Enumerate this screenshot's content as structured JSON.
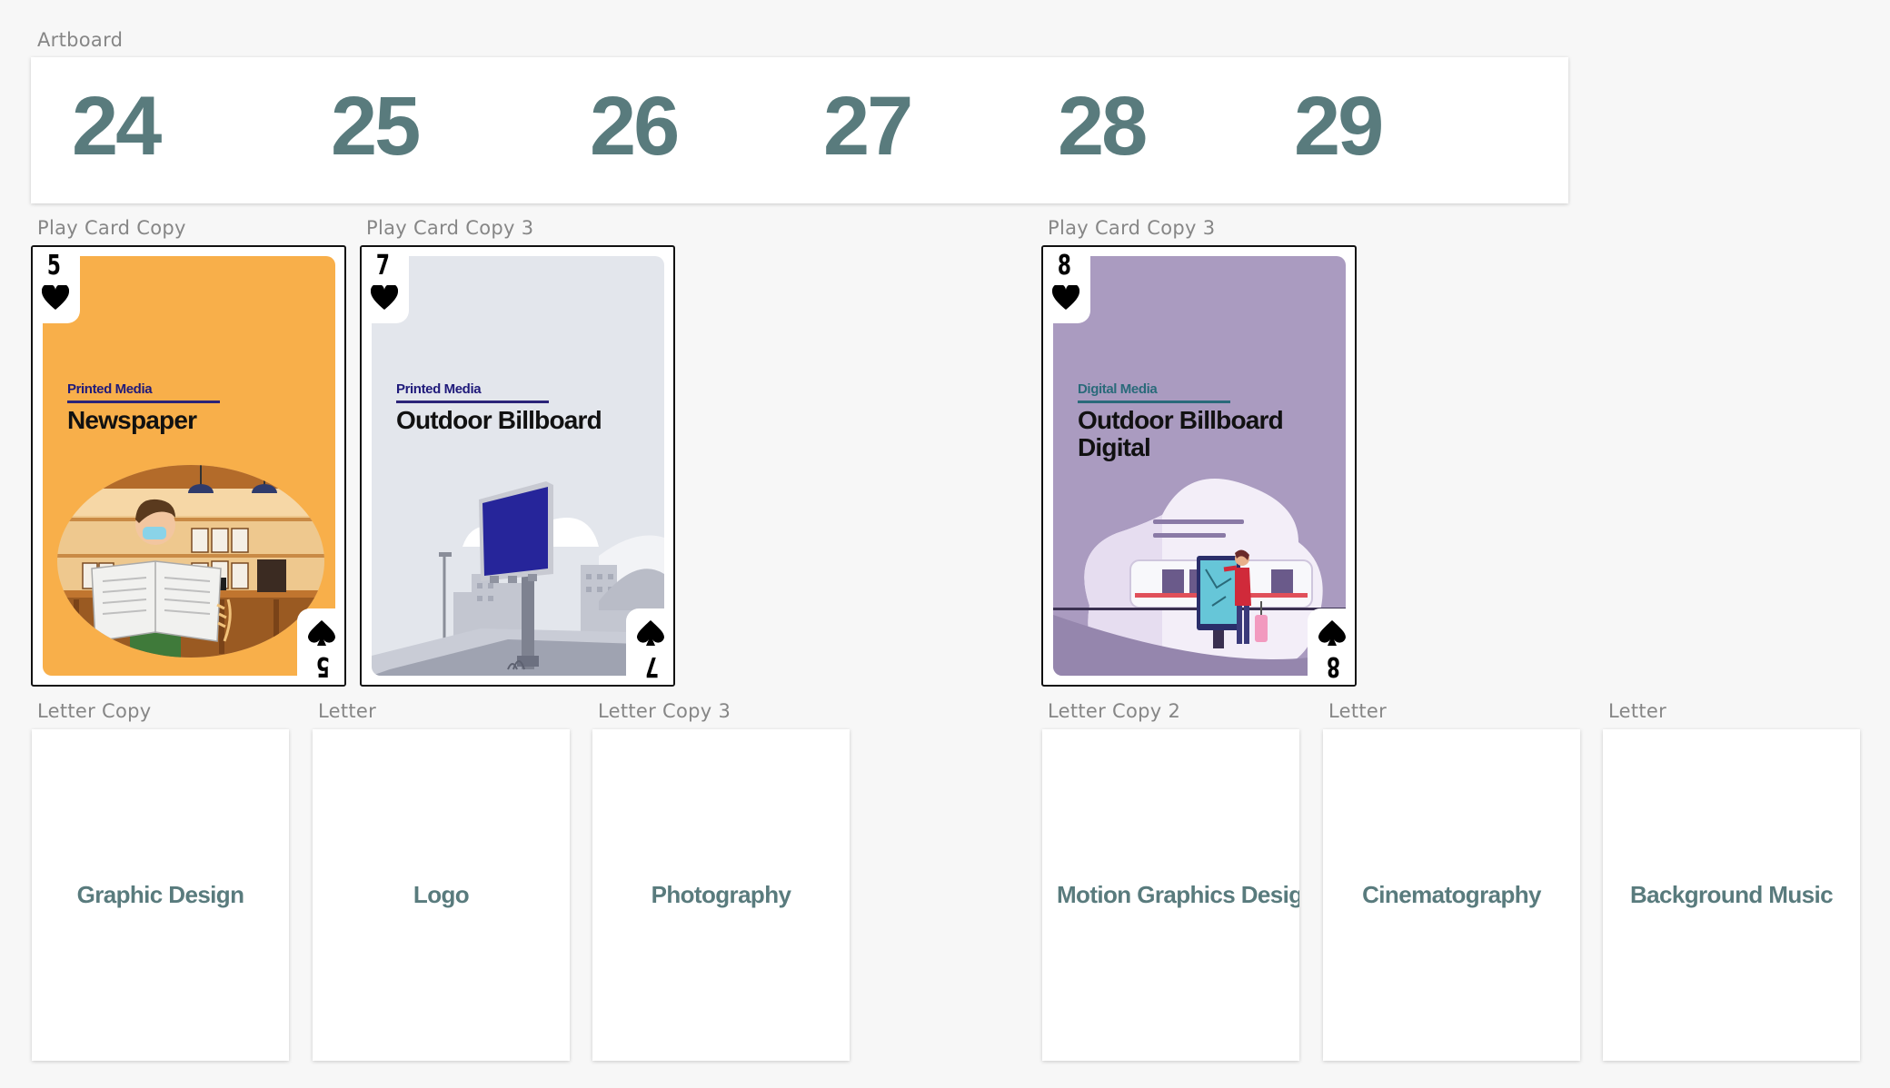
{
  "artboard": {
    "label": "Artboard",
    "numbers": [
      "24",
      "25",
      "26",
      "27",
      "28",
      "29"
    ]
  },
  "cards": [
    {
      "layer_label": "Play Card Copy",
      "rank": "5",
      "category": "Printed Media",
      "title": "Newspaper",
      "face_color": "#f8af4a",
      "illustration": "person-reading-newspaper"
    },
    {
      "layer_label": "Play Card Copy 3",
      "rank": "7",
      "category": "Printed Media",
      "title": "Outdoor Billboard",
      "face_color": "#e3e6ec",
      "illustration": "city-billboard"
    },
    {
      "layer_label": "Play Card Copy 3",
      "rank": "8",
      "category": "Digital Media",
      "title": "Outdoor Billboard Digital",
      "face_color": "#aa9bc0",
      "illustration": "digital-kiosk-train"
    }
  ],
  "letters": [
    {
      "layer_label": "Letter Copy",
      "text": "Graphic Design"
    },
    {
      "layer_label": "Letter",
      "text": "Logo"
    },
    {
      "layer_label": "Letter Copy 3",
      "text": "Photography"
    },
    {
      "layer_label": "Letter Copy 2",
      "text": "Motion Graphics Design"
    },
    {
      "layer_label": "Letter",
      "text": "Cinematography"
    },
    {
      "layer_label": "Letter",
      "text": "Background Music"
    }
  ],
  "colors": {
    "accent_text": "#597b7d",
    "printed_media_label": "#1f1a7a",
    "digital_media_label": "#2a6a7a"
  },
  "icons": {
    "heart": "heart-icon",
    "spade": "spade-icon"
  }
}
